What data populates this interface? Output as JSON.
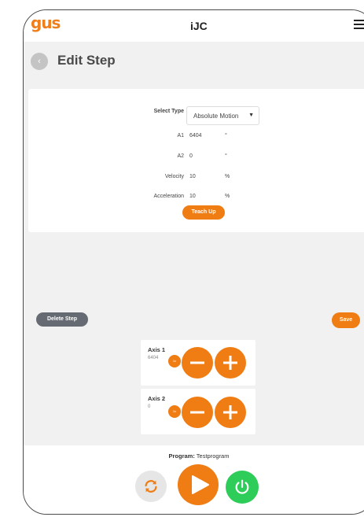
{
  "app": {
    "logo_text": "gus",
    "title": "iJC"
  },
  "header": {
    "back_icon": "arrow-left-icon",
    "page_title": "Edit Step"
  },
  "form": {
    "select_type_label": "Select Type",
    "select_type_value": "Absolute Motion",
    "fields": [
      {
        "label": "A1",
        "value": "6404",
        "unit": "°"
      },
      {
        "label": "A2",
        "value": "0",
        "unit": "°"
      },
      {
        "label": "Velocity",
        "value": "10",
        "unit": "%"
      },
      {
        "label": "Acceleration",
        "value": "10",
        "unit": "%"
      }
    ],
    "teach_up_label": "Teach Up"
  },
  "actions": {
    "delete_label": "Delete Step",
    "save_label": "Save"
  },
  "axes": [
    {
      "name": "Axis 1",
      "value": "6404",
      "step_label": "1x"
    },
    {
      "name": "Axis 2",
      "value": "0",
      "step_label": "1x"
    }
  ],
  "program": {
    "label": "Program:",
    "name": "Testprogram"
  },
  "colors": {
    "accent": "#ef7d14",
    "secondary": "#666b73",
    "power": "#2ecc59",
    "background": "#f1f1f1"
  }
}
